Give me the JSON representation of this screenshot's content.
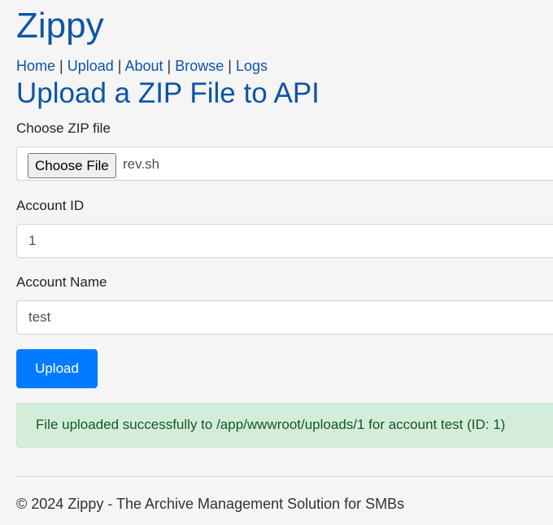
{
  "brand": "Zippy",
  "nav": {
    "home": "Home",
    "upload": "Upload",
    "about": "About",
    "browse": "Browse",
    "logs": "Logs",
    "separator": "|"
  },
  "page_title": "Upload a ZIP File to API",
  "form": {
    "file_label": "Choose ZIP file",
    "file_button": "Choose File",
    "file_name": "rev.sh",
    "account_id_label": "Account ID",
    "account_id_value": "1",
    "account_name_label": "Account Name",
    "account_name_value": "test",
    "submit_label": "Upload"
  },
  "alert": {
    "message": "File uploaded successfully to /app/wwwroot/uploads/1 for account test (ID: 1)"
  },
  "footer": {
    "text": "© 2024 Zippy - The Archive Management Solution for SMBs"
  },
  "colors": {
    "brand": "#0d55a6",
    "primary_button": "#007bff",
    "success_bg": "#d4edda",
    "success_text": "#155724"
  }
}
